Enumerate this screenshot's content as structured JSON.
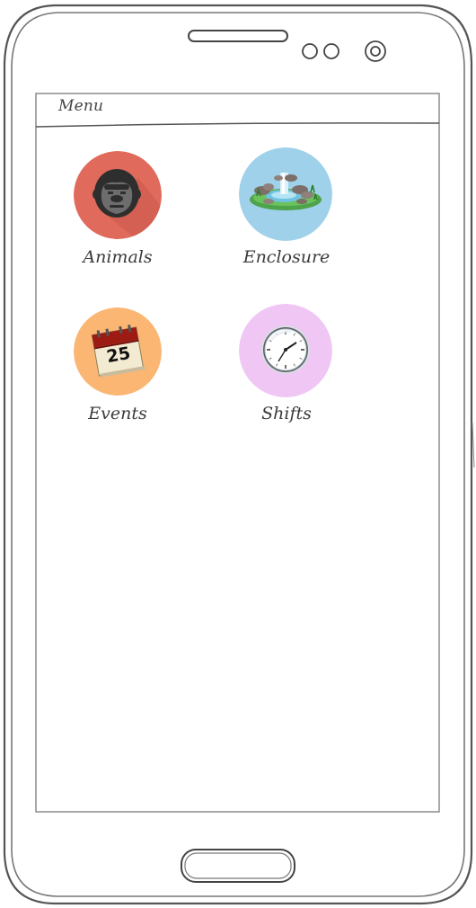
{
  "menu": {
    "title": "Menu"
  },
  "tiles": [
    {
      "label": "Animals",
      "icon": "gorilla-icon",
      "color": "#e06b5c"
    },
    {
      "label": "Enclosure",
      "icon": "pond-icon",
      "color": "#9fd1ea"
    },
    {
      "label": "Events",
      "icon": "calendar-icon",
      "color": "#fbb673",
      "calendar_day": "25"
    },
    {
      "label": "Shifts",
      "icon": "clock-icon",
      "color": "#f0c6f5"
    }
  ]
}
